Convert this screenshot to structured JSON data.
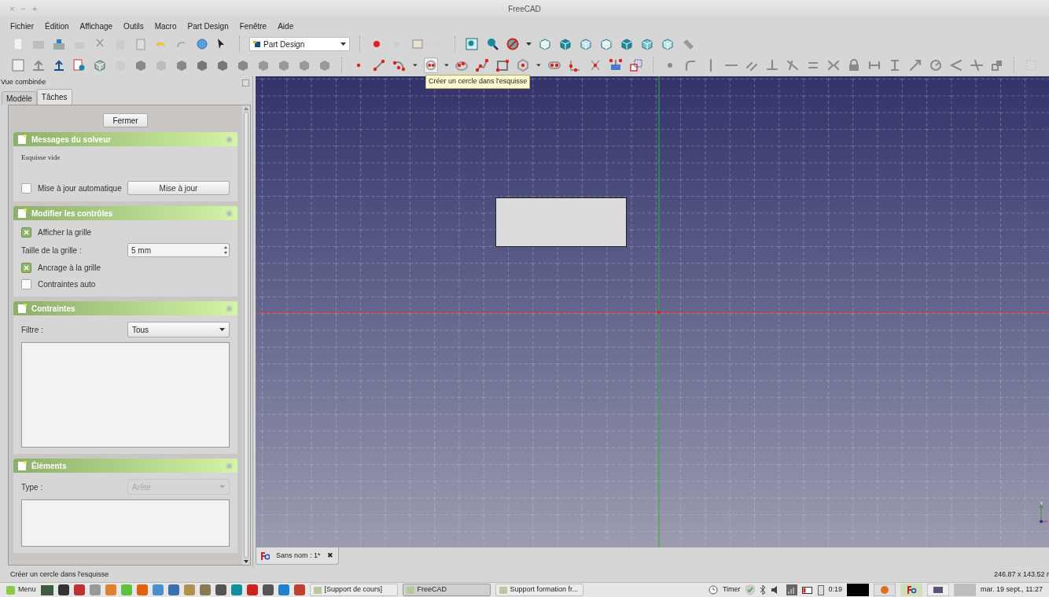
{
  "window": {
    "title": "FreeCAD",
    "controls": [
      "×",
      "−",
      "+"
    ]
  },
  "menu": [
    "Fichier",
    "Édition",
    "Affichage",
    "Outils",
    "Macro",
    "Part Design",
    "Fenêtre",
    "Aide"
  ],
  "workbench_selector": {
    "value": "Part Design"
  },
  "combo_view": {
    "title": "Vue combinée",
    "tabs": [
      {
        "label": "Modèle",
        "selected": false
      },
      {
        "label": "Tâches",
        "selected": true
      }
    ]
  },
  "tasks": {
    "close_button": "Fermer",
    "solver": {
      "title": "Messages du solveur",
      "message": "Esquisse vide",
      "auto_update": {
        "label": "Mise à jour automatique",
        "checked": false
      },
      "update_button": "Mise à jour"
    },
    "edit_controls": {
      "title": "Modifier les contrôles",
      "show_grid": {
        "label": "Afficher la grille",
        "checked": true
      },
      "grid_size": {
        "label": "Taille de la grille :",
        "value": "5 mm"
      },
      "grid_snap": {
        "label": "Ancrage à la grille",
        "checked": true
      },
      "auto_constraints": {
        "label": "Contraintes auto",
        "checked": false
      }
    },
    "constraints": {
      "title": "Contraintes",
      "filter": {
        "label": "Filtre :",
        "value": "Tous"
      }
    },
    "elements": {
      "title": "Éléments",
      "type": {
        "label": "Type :",
        "value": "Arête",
        "disabled": true
      }
    }
  },
  "tooltip": "Créer un cercle dans l'esquisse",
  "document_tab": {
    "label": "Sans nom : 1*",
    "close": "✖"
  },
  "status_bar": {
    "message": "Créer un cercle dans l'esquisse",
    "dimensions": "246.87 x 143.52 r"
  },
  "taskbar": {
    "menu_label": "Menu",
    "windows": [
      {
        "label": "[Support de cours]",
        "selected": false
      },
      {
        "label": "FreeCAD",
        "selected": true
      },
      {
        "label": "Support formation fr...",
        "selected": false
      }
    ],
    "timer": "Timer",
    "battery_time": "0:19",
    "clock": "mar. 19 sept., 11:27"
  }
}
